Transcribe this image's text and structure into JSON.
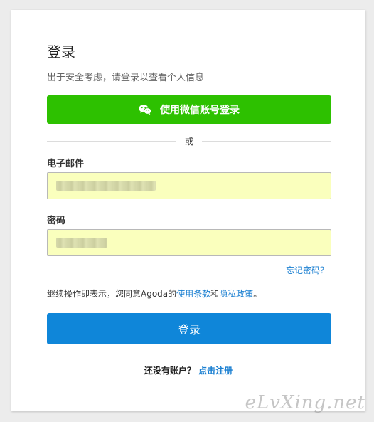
{
  "login": {
    "title": "登录",
    "subtitle": "出于安全考虑，请登录以查看个人信息",
    "wechat_button": "使用微信账号登录",
    "divider_text": "或",
    "email_label": "电子邮件",
    "password_label": "密码",
    "forgot_password": "忘记密码？",
    "terms_prefix": "继续操作即表示，您同意Agoda的",
    "terms_link": "使用条款",
    "terms_and": "和",
    "privacy_link": "隐私政策",
    "terms_suffix": "。",
    "login_button": "登录",
    "no_account": "还没有账户？",
    "register_link": "点击注册"
  },
  "watermark": "eLvXing.net",
  "colors": {
    "wechat_green": "#2dc100",
    "primary_blue": "#0f86d9",
    "link_blue": "#1a7fd1",
    "autofill_yellow": "#faffbd"
  }
}
